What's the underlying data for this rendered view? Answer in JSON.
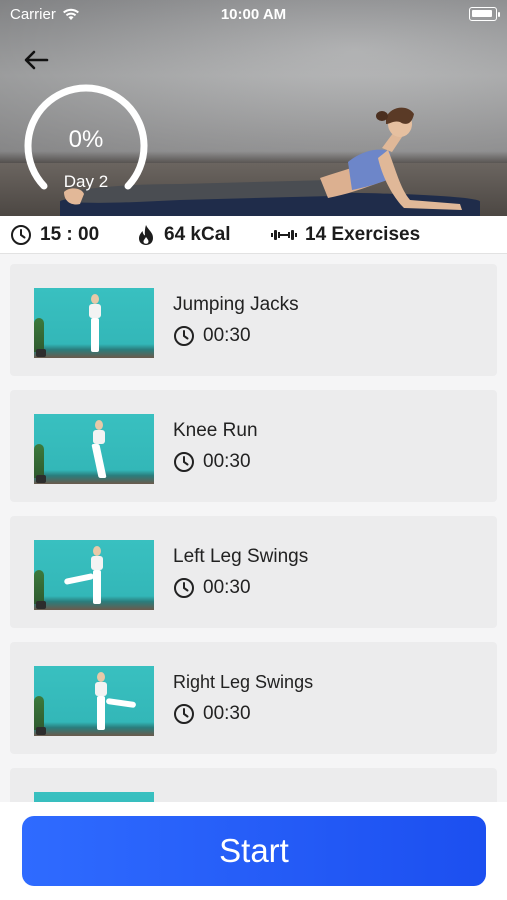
{
  "status_bar": {
    "carrier": "Carrier",
    "time": "10:00 AM",
    "wifi_icon": "wifi-icon",
    "battery_icon": "battery-icon"
  },
  "header": {
    "back_icon": "arrow-left-icon",
    "progress_value": 0,
    "progress_label": "0%",
    "day_label": "Day 2"
  },
  "stats": {
    "duration": "15 : 00",
    "duration_icon": "clock-icon",
    "calories": "64 kCal",
    "calories_icon": "flame-icon",
    "exercises": "14 Exercises",
    "exercises_icon": "dumbbell-icon"
  },
  "exercises": [
    {
      "title": "Jumping Jacks",
      "duration": "00:30"
    },
    {
      "title": "Knee Run",
      "duration": "00:30"
    },
    {
      "title": "Left Leg Swings",
      "duration": "00:30"
    },
    {
      "title": "Right Leg Swings",
      "duration": "00:30"
    }
  ],
  "footer": {
    "start_label": "Start"
  },
  "colors": {
    "accent": "#1c4ff0",
    "card_bg": "#ececed",
    "thumb_bg": "#36bcbc"
  }
}
